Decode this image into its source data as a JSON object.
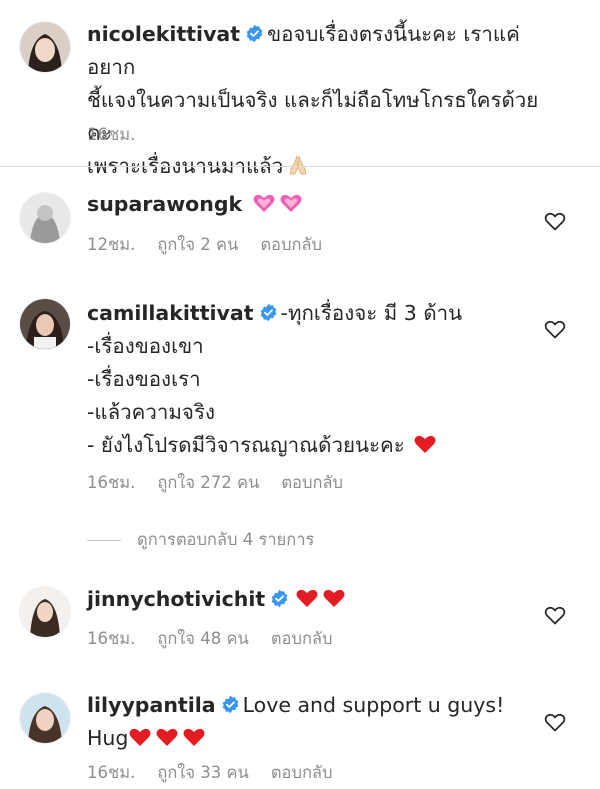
{
  "comments": [
    {
      "username": "nicolekittivat",
      "verified": true,
      "lines": [
        "ขอจบเรื่องตรงนี้นะคะ เราแค่อยาก",
        "ชี้แจงในความเป็นจริง และก็ไม่ถือโทษโกรธใครด้วยคะ",
        "เพราะเรื่องนานมาแล้ว"
      ],
      "emoji": "folded-hands-emoji",
      "time": "16ชม."
    },
    {
      "username": "suparawongk",
      "verified": false,
      "text": "",
      "emoji": "two-pink-hearts-emoji",
      "time": "12ชม.",
      "likes": "ถูกใจ 2 คน",
      "reply": "ตอบกลับ"
    },
    {
      "username": "camillakittivat",
      "verified": true,
      "first_line": "-ทุกเรื่องจะ มี 3 ด้าน",
      "lines": [
        "-เรื่องของเขา",
        "-เรื่องของเรา",
        "-แล้วความจริง",
        "- ยังไงโปรดมีวิจารณญาณด้วยนะคะ"
      ],
      "emoji": "red-heart-emoji",
      "time": "16ชม.",
      "likes": "ถูกใจ 272 คน",
      "reply": "ตอบกลับ"
    },
    {
      "username": "jinnychotivichit",
      "verified": true,
      "emoji": "two-red-hearts-emoji",
      "time": "16ชม.",
      "likes": "ถูกใจ 48 คน",
      "reply": "ตอบกลับ"
    },
    {
      "username": "lilyypantila",
      "verified": true,
      "first_line": "Love and support u guys!",
      "second_line": "Hug",
      "emoji": "three-red-hearts-emoji",
      "time": "16ชม.",
      "likes": "ถูกใจ 33 คน",
      "reply": "ตอบกลับ"
    }
  ],
  "view_replies": "ดูการตอบกลับ 4 รายการ",
  "colors": {
    "text": "#262626",
    "meta": "#8e8e8e",
    "verified": "#3897f0",
    "heart": "#e31b23",
    "pink_heart": "#f05fb4",
    "divider": "#dbdbdb"
  }
}
